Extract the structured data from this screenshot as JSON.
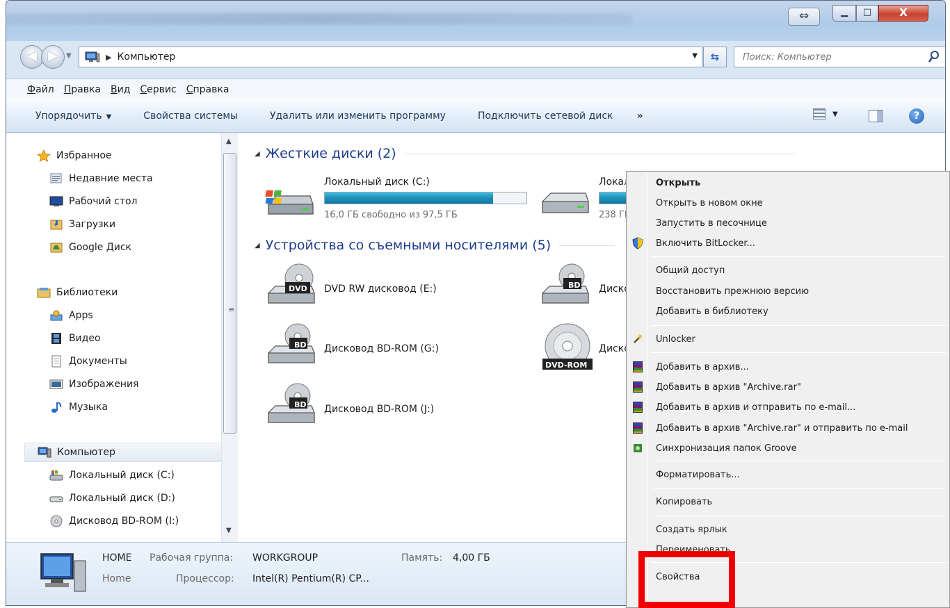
{
  "window": {
    "minimize_glyph": "▁",
    "maximize_glyph": "□",
    "close_glyph": "X",
    "snap_glyph": "⇔"
  },
  "address": {
    "crumb": "Компьютер",
    "search_placeholder": "Поиск: Компьютер"
  },
  "menubar": [
    "Файл",
    "Правка",
    "Вид",
    "Сервис",
    "Справка"
  ],
  "cmdbar": {
    "organize": "Упорядочить",
    "system_properties": "Свойства системы",
    "uninstall": "Удалить или изменить программу",
    "map_drive": "Подключить сетевой диск",
    "more": "»"
  },
  "navpane": {
    "favorites": "Избранное",
    "recent": "Недавние места",
    "desktop": "Рабочий стол",
    "downloads": "Загрузки",
    "google_drive": "Google Диск",
    "libraries": "Библиотеки",
    "apps": "Apps",
    "video": "Видео",
    "documents": "Документы",
    "images": "Изображения",
    "music": "Музыка",
    "computer": "Компьютер",
    "disk_c": "Локальный диск (C:)",
    "disk_d": "Локальный диск (D:)",
    "bd_i": "Дисковод BD-ROM (I:)"
  },
  "content": {
    "hard_disks_header": "Жесткие диски (2)",
    "removable_header": "Устройства со съемными носителями (5)",
    "disk_c_label": "Локальный диск (C:)",
    "disk_c_free": "16,0 ГБ свободно из 97,5 ГБ",
    "disk_c_used_fraction": 0.836,
    "disk_d_label_partial": "Локал",
    "disk_d_free_partial": "238 ГБ",
    "dvd_e": "DVD RW дисковод (E:)",
    "bd_g": "Дисковод BD-ROM (G:)",
    "bd_j": "Дисковод BD-ROM (J:)",
    "partial_right_1": "Диско",
    "partial_right_2": "Диско",
    "dvd_badge": "DVD",
    "bd_badge": "BD",
    "dvdrom_badge": "DVD-ROM"
  },
  "details": {
    "computer_name": "HOME",
    "workgroup_label": "Рабочая группа:",
    "workgroup": "WORKGROUP",
    "memory_label": "Память:",
    "memory": "4,00 ГБ",
    "domain_name": "Home",
    "cpu_label": "Процессор:",
    "cpu": "Intel(R) Pentium(R) CP..."
  },
  "context_menu": {
    "open": "Открыть",
    "open_new_window": "Открыть в новом окне",
    "run_sandbox": "Запустить в песочнице",
    "bitlocker": "Включить BitLocker...",
    "sharing": "Общий доступ",
    "restore": "Восстановить прежнюю версию",
    "add_library": "Добавить в библиотеку",
    "unlocker": "Unlocker",
    "add_archive": "Добавить в архив...",
    "add_archive_rar": "Добавить в архив \"Archive.rar\"",
    "add_archive_email": "Добавить в архив и отправить по e-mail...",
    "add_archive_rar_email": "Добавить в архив \"Archive.rar\" и отправить по e-mail",
    "groove": "Синхронизация папок Groove",
    "format": "Форматировать...",
    "copy": "Копировать",
    "shortcut": "Создать ярлык",
    "rename": "Переименовать",
    "properties": "Свойства"
  },
  "colors": {
    "highlight_box": "#f00000",
    "group_header": "#1e3e8c",
    "usage_bar": "#1e8fb8"
  }
}
